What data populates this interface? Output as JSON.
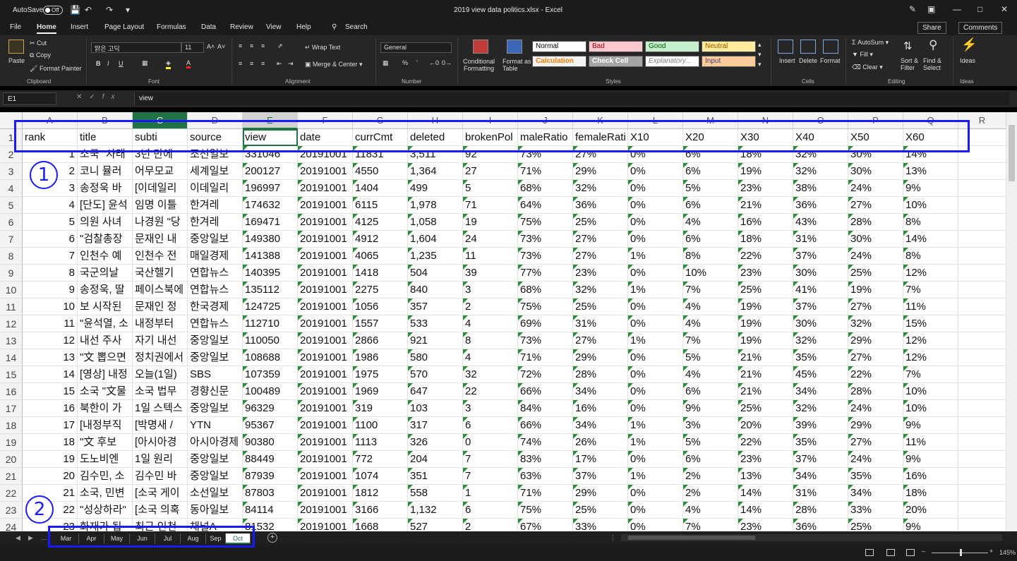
{
  "titlebar": {
    "autosave_label": "AutoSave",
    "autosave_state": "Off",
    "window_title": "2019 view data politics.xlsx - Excel"
  },
  "ribbon_tabs": [
    "File",
    "Home",
    "Insert",
    "Page Layout",
    "Formulas",
    "Data",
    "Review",
    "View",
    "Help"
  ],
  "ribbon_tab_active": "Home",
  "search_label": "Search",
  "share_label": "Share",
  "comments_label": "Comments",
  "clipboard": {
    "paste": "Paste",
    "cut": "Cut",
    "copy": "Copy",
    "format_painter": "Format Painter",
    "group": "Clipboard"
  },
  "font": {
    "name": "맑은 고딕",
    "size": "11",
    "group": "Font"
  },
  "alignment": {
    "wrap_text": "Wrap Text",
    "merge_center": "Merge & Center",
    "group": "Alignment"
  },
  "number": {
    "format": "General",
    "group": "Number"
  },
  "styles": {
    "conditional_formatting": [
      "Conditional",
      "Formatting"
    ],
    "format_as_table": [
      "Format as",
      "Table"
    ],
    "cells": [
      {
        "label": "Normal",
        "bg": "#ffffff",
        "fg": "#000000"
      },
      {
        "label": "Bad",
        "bg": "#ffc7ce",
        "fg": "#9c0006"
      },
      {
        "label": "Good",
        "bg": "#c6efce",
        "fg": "#006100"
      },
      {
        "label": "Neutral",
        "bg": "#ffeb9c",
        "fg": "#9c5700"
      },
      {
        "label": "Calculation",
        "bg": "#f2f2f2",
        "fg": "#fa7d00"
      },
      {
        "label": "Check Cell",
        "bg": "#a5a5a5",
        "fg": "#ffffff"
      },
      {
        "label": "Explanatory...",
        "bg": "#ffffff",
        "fg": "#7f7f7f"
      },
      {
        "label": "Input",
        "bg": "#ffcc99",
        "fg": "#3f3f76"
      }
    ],
    "group": "Styles"
  },
  "cells_group": {
    "insert": "Insert",
    "delete": "Delete",
    "format": "Format",
    "group": "Cells"
  },
  "editing": {
    "autosum": "AutoSum",
    "fill": "Fill",
    "clear": "Clear",
    "sort_filter": [
      "Sort &",
      "Filter"
    ],
    "find_select": [
      "Find &",
      "Select"
    ],
    "group": "Editing"
  },
  "ideas": {
    "label": "Ideas",
    "group": "Ideas"
  },
  "formula_bar": {
    "name_box": "E1",
    "fx": "fx",
    "content": "view"
  },
  "columns": [
    "A",
    "B",
    "C",
    "D",
    "E",
    "F",
    "G",
    "H",
    "I",
    "J",
    "K",
    "L",
    "M",
    "N",
    "O",
    "P",
    "Q",
    "R"
  ],
  "row_numbers": [
    "1",
    "2",
    "3",
    "4",
    "5",
    "6",
    "7",
    "8",
    "9",
    "10",
    "11",
    "12",
    "13",
    "14",
    "15",
    "16",
    "17",
    "18",
    "19",
    "20",
    "21",
    "22",
    "23",
    "24"
  ],
  "header_row": [
    "rank",
    "title",
    "subti",
    "source",
    "view",
    "date",
    "currCmt",
    "deleted",
    "brokenPol",
    "maleRatio",
    "femaleRati",
    "X10",
    "X20",
    "X30",
    "X40",
    "X50",
    "X60"
  ],
  "rows": [
    [
      "1",
      "소국 \"사태",
      "3년 만에 ",
      "조선일보",
      "331046",
      "20191001",
      "11831",
      "3,511",
      "92",
      "73%",
      "27%",
      "0%",
      "6%",
      "18%",
      "32%",
      "30%",
      "14%"
    ],
    [
      "2",
      "코니 뮬러 ",
      "어무모교 ",
      "세계일보",
      "200127",
      "20191001",
      "4550",
      "1,364",
      "27",
      "71%",
      "29%",
      "0%",
      "6%",
      "19%",
      "32%",
      "30%",
      "13%"
    ],
    [
      "3",
      "송정욱 바",
      "[이데일리",
      "이데일리",
      "196997",
      "20191001",
      "1404",
      "499",
      "5",
      "68%",
      "32%",
      "0%",
      "5%",
      "23%",
      "38%",
      "24%",
      "9%"
    ],
    [
      "4",
      "[단도] 윤석",
      "임명 이틀",
      "한겨레",
      "174632",
      "20191001",
      "6115",
      "1,978",
      "71",
      "64%",
      "36%",
      "0%",
      "6%",
      "21%",
      "36%",
      "27%",
      "10%"
    ],
    [
      "5",
      "의원 사녀",
      "나경원 \"당",
      "한겨레",
      "169471",
      "20191001",
      "4125",
      "1,058",
      "19",
      "75%",
      "25%",
      "0%",
      "4%",
      "16%",
      "43%",
      "28%",
      "8%"
    ],
    [
      "6",
      "\"검찰총장",
      "문재인 내",
      "중앙일보",
      "149380",
      "20191001",
      "4912",
      "1,604",
      "24",
      "73%",
      "27%",
      "0%",
      "6%",
      "18%",
      "31%",
      "30%",
      "14%"
    ],
    [
      "7",
      "인천수 예",
      "인천수 전",
      "매일경제",
      "141388",
      "20191001",
      "4065",
      "1,235",
      "11",
      "73%",
      "27%",
      "1%",
      "8%",
      "22%",
      "37%",
      "24%",
      "8%"
    ],
    [
      "8",
      "국군의날 ",
      "국산헬기 ",
      "연합뉴스",
      "140395",
      "20191001",
      "1418",
      "504",
      "39",
      "77%",
      "23%",
      "0%",
      "10%",
      "23%",
      "30%",
      "25%",
      "12%"
    ],
    [
      "9",
      "송정욱, 딸",
      "페이스북에",
      "연합뉴스",
      "135112",
      "20191001",
      "2275",
      "840",
      "3",
      "68%",
      "32%",
      "1%",
      "7%",
      "25%",
      "41%",
      "19%",
      "7%"
    ],
    [
      "10",
      "보 시작된 ",
      "문재인 정",
      "한국경제",
      "124725",
      "20191001",
      "1056",
      "357",
      "2",
      "75%",
      "25%",
      "0%",
      "4%",
      "19%",
      "37%",
      "27%",
      "11%"
    ],
    [
      "11",
      "\"윤석열, 소",
      "내정부터 ",
      "연합뉴스",
      "112710",
      "20191001",
      "1557",
      "533",
      "4",
      "69%",
      "31%",
      "0%",
      "4%",
      "19%",
      "30%",
      "32%",
      "15%"
    ],
    [
      "12",
      "내선 주사",
      "자기 내선",
      "중앙일보",
      "110050",
      "20191001",
      "2866",
      "921",
      "8",
      "73%",
      "27%",
      "1%",
      "7%",
      "19%",
      "32%",
      "29%",
      "12%"
    ],
    [
      "13",
      "\"文 뽑으면",
      "정치권에서",
      "중앙일보",
      "108688",
      "20191001",
      "1986",
      "580",
      "4",
      "71%",
      "29%",
      "0%",
      "5%",
      "21%",
      "35%",
      "27%",
      "12%"
    ],
    [
      "14",
      "[영상] 내정",
      "오늘(1일)",
      "SBS",
      "107359",
      "20191001",
      "1975",
      "570",
      "32",
      "72%",
      "28%",
      "0%",
      "4%",
      "21%",
      "45%",
      "22%",
      "7%"
    ],
    [
      "15",
      "소국 \"文물",
      "소국 법무",
      "경향신문",
      "100489",
      "20191001",
      "1969",
      "647",
      "22",
      "66%",
      "34%",
      "0%",
      "6%",
      "21%",
      "34%",
      "28%",
      "10%"
    ],
    [
      "16",
      "북한이 가",
      "1일 스텍스",
      "중앙일보",
      "96329",
      "20191001",
      "319",
      "103",
      "3",
      "84%",
      "16%",
      "0%",
      "9%",
      "25%",
      "32%",
      "24%",
      "10%"
    ],
    [
      "17",
      "[내정부직",
      "[박명새 / ",
      "YTN",
      "95367",
      "20191001",
      "1100",
      "317",
      "6",
      "66%",
      "34%",
      "1%",
      "3%",
      "20%",
      "39%",
      "29%",
      "9%"
    ],
    [
      "18",
      "\"文 후보 ",
      "[아시아경",
      "아시아경제",
      "90380",
      "20191001",
      "1113",
      "326",
      "0",
      "74%",
      "26%",
      "1%",
      "5%",
      "22%",
      "35%",
      "27%",
      "11%"
    ],
    [
      "19",
      "도노비엔 ",
      "1일 원리 ",
      "중앙일보",
      "88449",
      "20191001",
      "772",
      "204",
      "7",
      "83%",
      "17%",
      "0%",
      "6%",
      "23%",
      "37%",
      "24%",
      "9%"
    ],
    [
      "20",
      "김수민, 소",
      "김수민 바",
      "중앙일보",
      "87939",
      "20191001",
      "1074",
      "351",
      "7",
      "63%",
      "37%",
      "1%",
      "2%",
      "13%",
      "34%",
      "35%",
      "16%"
    ],
    [
      "21",
      "소국, 민변",
      "[소국 게이",
      "소선일보",
      "87803",
      "20191001",
      "1812",
      "558",
      "1",
      "71%",
      "29%",
      "0%",
      "2%",
      "14%",
      "31%",
      "34%",
      "18%"
    ],
    [
      "22",
      "\"성상하라\"",
      "[소국 의혹",
      "동아일보",
      "84114",
      "20191001",
      "3166",
      "1,132",
      "6",
      "75%",
      "25%",
      "0%",
      "4%",
      "14%",
      "28%",
      "33%",
      "20%"
    ],
    [
      "23",
      "화재가 됩",
      "최근 인천",
      "채널A",
      "81532",
      "20191001",
      "1668",
      "527",
      "2",
      "67%",
      "33%",
      "0%",
      "7%",
      "23%",
      "36%",
      "25%",
      "9%"
    ]
  ],
  "sheet_tabs": [
    "Mar",
    "Apr",
    "May",
    "Jun",
    "Jul",
    "Aug",
    "Sep",
    "Oct"
  ],
  "sheet_active": "Oct",
  "zoom": "145%",
  "annotations": [
    "1",
    "2"
  ],
  "accent_color": "#217346",
  "annotation_color": "#1a1aff"
}
